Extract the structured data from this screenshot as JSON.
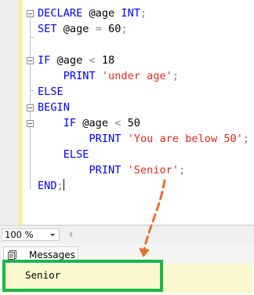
{
  "editor": {
    "lines": [
      {
        "tokens": [
          {
            "t": "DECLARE",
            "c": "kw"
          },
          {
            "t": " @age ",
            "c": "plain"
          },
          {
            "t": "INT",
            "c": "kw"
          },
          {
            "t": ";",
            "c": "op"
          }
        ]
      },
      {
        "tokens": [
          {
            "t": "SET",
            "c": "kw"
          },
          {
            "t": " @age ",
            "c": "plain"
          },
          {
            "t": "=",
            "c": "op"
          },
          {
            "t": " 60",
            "c": "plain"
          },
          {
            "t": ";",
            "c": "op"
          }
        ]
      },
      {
        "tokens": []
      },
      {
        "tokens": [
          {
            "t": "IF",
            "c": "kw"
          },
          {
            "t": " @age ",
            "c": "plain"
          },
          {
            "t": "<",
            "c": "op"
          },
          {
            "t": " 18",
            "c": "plain"
          }
        ]
      },
      {
        "tokens": [
          {
            "t": "    PRINT ",
            "c": "kw"
          },
          {
            "t": "'under age'",
            "c": "str"
          },
          {
            "t": ";",
            "c": "op"
          }
        ]
      },
      {
        "tokens": [
          {
            "t": "ELSE",
            "c": "kw"
          }
        ]
      },
      {
        "tokens": [
          {
            "t": "BEGIN",
            "c": "kw"
          }
        ]
      },
      {
        "tokens": [
          {
            "t": "    IF",
            "c": "kw"
          },
          {
            "t": " @age ",
            "c": "plain"
          },
          {
            "t": "<",
            "c": "op"
          },
          {
            "t": " 50",
            "c": "plain"
          }
        ]
      },
      {
        "tokens": [
          {
            "t": "        PRINT ",
            "c": "kw"
          },
          {
            "t": "'You are below 50'",
            "c": "str"
          },
          {
            "t": ";",
            "c": "op"
          }
        ]
      },
      {
        "tokens": [
          {
            "t": "    ELSE",
            "c": "kw"
          }
        ]
      },
      {
        "tokens": [
          {
            "t": "        PRINT ",
            "c": "kw"
          },
          {
            "t": "'Senior'",
            "c": "str"
          },
          {
            "t": ";",
            "c": "op"
          }
        ]
      },
      {
        "tokens": [
          {
            "t": "END",
            "c": "kw"
          },
          {
            "t": ";",
            "c": "op"
          }
        ],
        "caret": true
      }
    ]
  },
  "zoom": {
    "value": "100 %"
  },
  "results": {
    "tab_label": "Messages",
    "messages": [
      "Senior"
    ]
  },
  "colors": {
    "keyword": "#0000ff",
    "string": "#e0271c",
    "operator": "#808080",
    "message_background": "#fbf8cd",
    "annotation_arrow": "#e8712a",
    "annotation_box": "#1ab84a"
  },
  "icons": {
    "messages_tab": "messages-icon",
    "fold_toggle": "collapse-icon",
    "zoom_dropdown": "chevron-down-icon",
    "scroll_left": "scroll-left-arrow-icon"
  }
}
